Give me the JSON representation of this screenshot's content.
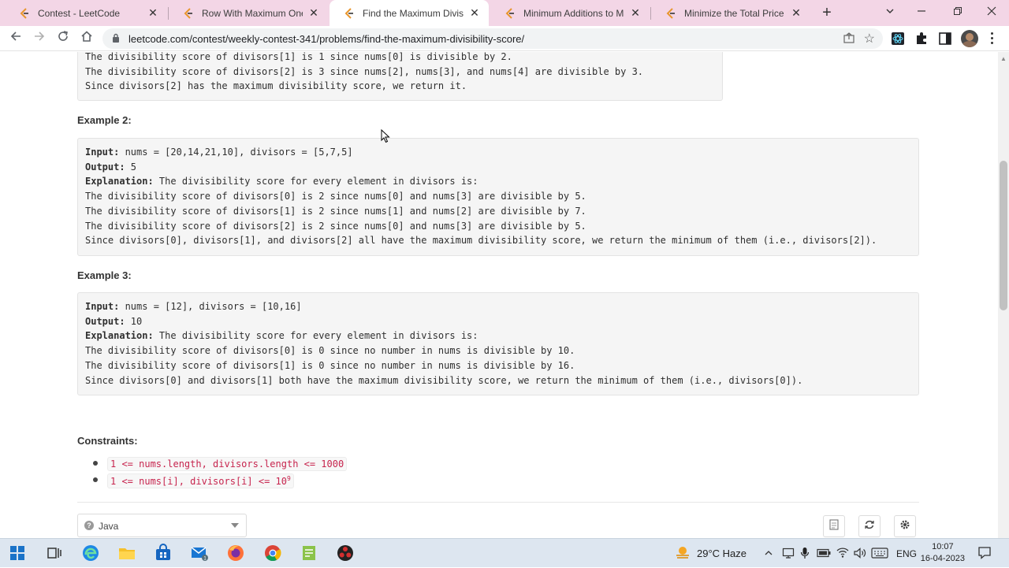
{
  "browser": {
    "tabs": [
      {
        "title": "Contest - LeetCode",
        "active": false
      },
      {
        "title": "Row With Maximum Ones - L",
        "active": false
      },
      {
        "title": "Find the Maximum Divisibilit",
        "active": true
      },
      {
        "title": "Minimum Additions to Make",
        "active": false
      },
      {
        "title": "Minimize the Total Price of th",
        "active": false
      }
    ],
    "close_glyph": "✕",
    "new_tab_glyph": "+",
    "url": "leetcode.com/contest/weekly-contest-341/problems/find-the-maximum-divisibility-score/"
  },
  "page": {
    "example1_tail": [
      "The divisibility score of divisors[1] is 1 since nums[0] is divisible by 2.",
      "The divisibility score of divisors[2] is 3 since nums[2], nums[3], and nums[4] are divisible by 3.",
      "Since divisors[2] has the maximum divisibility score, we return it."
    ],
    "example2": {
      "title": "Example 2:",
      "input_label": "Input:",
      "input_value": " nums = [20,14,21,10], divisors = [5,7,5]",
      "output_label": "Output:",
      "output_value": " 5",
      "explanation_label": "Explanation:",
      "explanation_value": " The divisibility score for every element in divisors is:",
      "lines": [
        "The divisibility score of divisors[0] is 2 since nums[0] and nums[3] are divisible by 5.",
        "The divisibility score of divisors[1] is 2 since nums[1] and nums[2] are divisible by 7.",
        "The divisibility score of divisors[2] is 2 since nums[0] and nums[3] are divisible by 5.",
        "Since divisors[0], divisors[1], and divisors[2] all have the maximum divisibility score, we return the minimum of them (i.e., divisors[2])."
      ]
    },
    "example3": {
      "title": "Example 3:",
      "input_label": "Input:",
      "input_value": " nums = [12], divisors = [10,16]",
      "output_label": "Output:",
      "output_value": " 10",
      "explanation_label": "Explanation:",
      "explanation_value": " The divisibility score for every element in divisors is:",
      "lines": [
        "The divisibility score of divisors[0] is 0 since no number in nums is divisible by 10.",
        "The divisibility score of divisors[1] is 0 since no number in nums is divisible by 16.",
        "Since divisors[0] and divisors[1] both have the maximum divisibility score, we return the minimum of them (i.e., divisors[0])."
      ]
    },
    "constraints_title": "Constraints:",
    "constraints": [
      {
        "text": "1 <= nums.length, divisors.length <= 1000",
        "sup": ""
      },
      {
        "text": "1 <= nums[i], divisors[i] <= 10",
        "sup": "9"
      }
    ],
    "language": "Java",
    "help_glyph": "?"
  },
  "taskbar": {
    "weather_temp": "29°C",
    "weather_desc": "Haze",
    "language": "ENG",
    "time": "10:07",
    "date": "16-04-2023"
  },
  "colors": {
    "tab_strip": "#f3d6e6",
    "code_bg": "#f5f5f5",
    "constraint_code": "#c7254e",
    "taskbar": "#dde6f0"
  }
}
